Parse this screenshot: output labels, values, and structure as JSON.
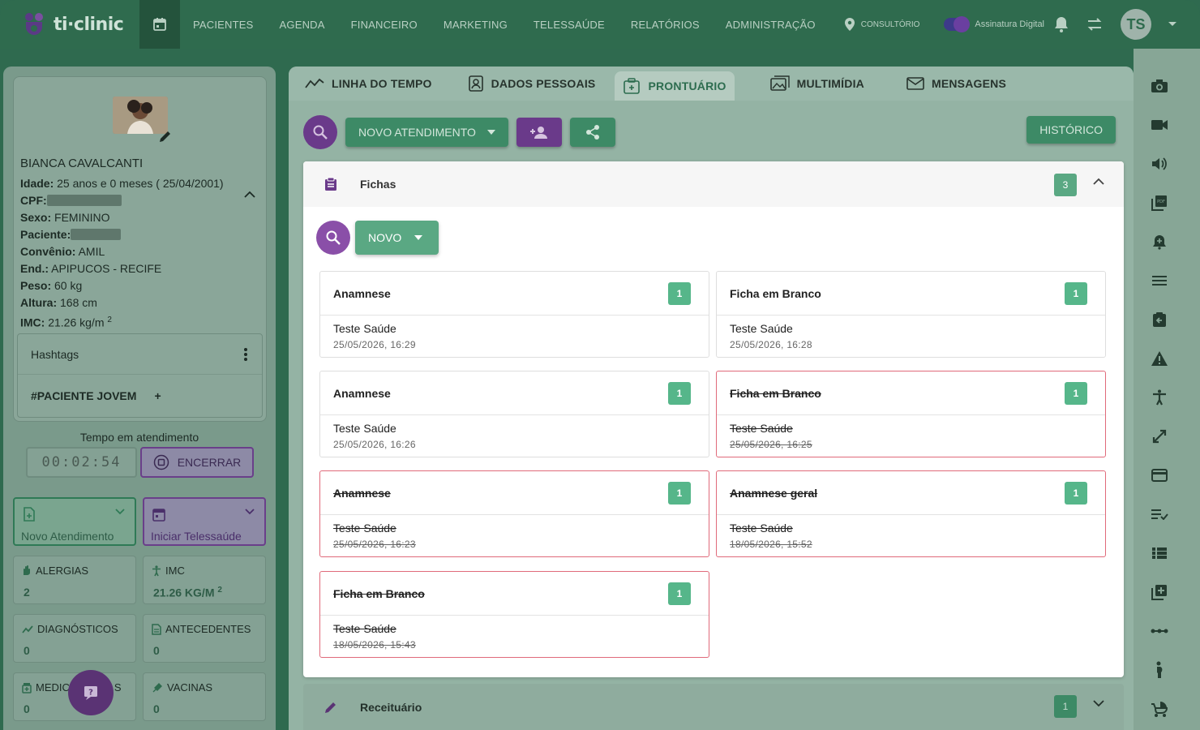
{
  "brand": {
    "name": "ti·clinic"
  },
  "nav": [
    "PACIENTES",
    "AGENDA",
    "FINANCEIRO",
    "MARKETING",
    "TELESSAÚDE",
    "RELATÓRIOS",
    "ADMINISTRAÇÃO"
  ],
  "topbar": {
    "location": "CONSULTÓRIO",
    "signature_label": "Assinatura Digital",
    "user_initials": "TS"
  },
  "patient": {
    "name": "BIANCA CAVALCANTI",
    "idade_label": "Idade:",
    "idade": " 25 anos e 0 meses ( 25/04/2001)",
    "cpf_label": "CPF:",
    "sexo_label": "Sexo:",
    "sexo": " FEMININO",
    "paciente_label": "Paciente:",
    "convenio_label": "Convênio:",
    "convenio": " AMIL",
    "end_label": "End.:",
    "end": " APIPUCOS -  RECIFE",
    "peso_label": "Peso:",
    "peso": " 60 kg",
    "altura_label": "Altura:",
    "altura": " 168 cm",
    "imc_label": "IMC:",
    "imc": " 21.26 kg/m ",
    "imc_sup": "2"
  },
  "hashtags": {
    "title": "Hashtags",
    "tag": "#PACIENTE JOVEM",
    "add": "+"
  },
  "timer": {
    "label": "Tempo em atendimento",
    "value": "00:02:54",
    "end_button": "ENCERRAR"
  },
  "actions": {
    "novo_atendimento": "Novo Atendimento",
    "iniciar_telessaude": "Iniciar Telessaúde"
  },
  "stats": [
    {
      "label": "ALERGIAS",
      "value": "2"
    },
    {
      "label": "IMC",
      "value": "21.26 KG/M ",
      "sup": "2"
    },
    {
      "label": "DIAGNÓSTICOS",
      "value": "0"
    },
    {
      "label": "ANTECEDENTES",
      "value": "0"
    },
    {
      "label": "MEDIC",
      "label_end": "S",
      "value": "0"
    },
    {
      "label": "VACINAS",
      "value": "0"
    }
  ],
  "tabs": [
    "LINHA DO TEMPO",
    "DADOS PESSOAIS",
    "PRONTUÁRIO",
    "MULTIMÍDIA",
    "MENSAGENS"
  ],
  "toolbar": {
    "novo_atendimento": "NOVO ATENDIMENTO",
    "historico": "HISTÓRICO"
  },
  "fichas": {
    "title": "Fichas",
    "count": "3",
    "novo": "NOVO",
    "cards": [
      {
        "title": "Anamnese",
        "badge": "1",
        "author": "Teste Saúde",
        "date": "25/05/2026, 16:29",
        "deleted": false
      },
      {
        "title": "Ficha em Branco",
        "badge": "1",
        "author": "Teste Saúde",
        "date": "25/05/2026, 16:28",
        "deleted": false
      },
      {
        "title": "Anamnese",
        "badge": "1",
        "author": "Teste Saúde",
        "date": "25/05/2026, 16:26",
        "deleted": false
      },
      {
        "title": "Ficha em Branco",
        "badge": "1",
        "author": "Teste Saúde",
        "date": "25/05/2026, 16:25",
        "deleted": true
      },
      {
        "title": "Anamnese",
        "badge": "1",
        "author": "Teste Saúde",
        "date": "25/05/2026, 16:23",
        "deleted": true
      },
      {
        "title": "Anamnese geral",
        "badge": "1",
        "author": "Teste Saúde",
        "date": "18/05/2026, 15:52",
        "deleted": true
      },
      {
        "title": "Ficha em Branco",
        "badge": "1",
        "author": "Teste Saúde",
        "date": "18/05/2026, 15:43",
        "deleted": true
      }
    ]
  },
  "receituario": {
    "title": "Receituário",
    "count": "1"
  },
  "rail_icons": [
    "camera-icon",
    "video-icon",
    "volume-icon",
    "pdf-icon",
    "alarm-add-icon",
    "list-icon",
    "clipboard-back-icon",
    "warning-icon",
    "accessibility-icon",
    "expand-icon",
    "card-icon",
    "checklist-icon",
    "view-list-icon",
    "add-box-icon",
    "dots-icon",
    "pregnant-icon",
    "stroller-icon"
  ],
  "colors": {
    "primary_green": "#3d8a66",
    "purple": "#6a3a8a",
    "deleted_border": "#e06a7a",
    "badge_green": "#56b68a"
  }
}
